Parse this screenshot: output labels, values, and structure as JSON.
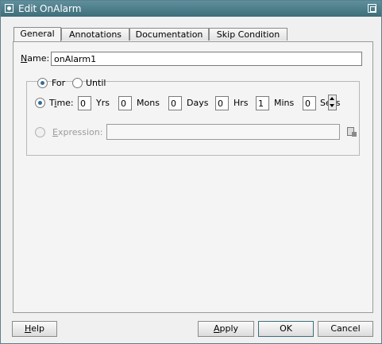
{
  "window": {
    "title": "Edit OnAlarm"
  },
  "tabs": [
    {
      "label": "General",
      "active": true
    },
    {
      "label": "Annotations",
      "active": false
    },
    {
      "label": "Documentation",
      "active": false
    },
    {
      "label": "Skip Condition",
      "active": false
    }
  ],
  "name": {
    "label": "Name:",
    "label_mnemonic": "N",
    "label_rest": "ame:",
    "value": "onAlarm1"
  },
  "mode": {
    "for_label": "For",
    "for_selected": true,
    "until_label": "Until",
    "until_selected": false
  },
  "time": {
    "label_mnemonic_pre": "T",
    "label_mnemonic": "i",
    "label_rest": "me:",
    "selected": true,
    "fields": [
      {
        "value": "0",
        "unit": "Yrs"
      },
      {
        "value": "0",
        "unit": "Mons"
      },
      {
        "value": "0",
        "unit": "Days"
      },
      {
        "value": "0",
        "unit": "Hrs"
      },
      {
        "value": "1",
        "unit": "Mins"
      },
      {
        "value": "0",
        "unit": "Secs"
      }
    ]
  },
  "expression": {
    "label_mnemonic": "E",
    "label_rest": "xpression:",
    "value": "",
    "enabled": false
  },
  "buttons": {
    "help_mnemonic": "H",
    "help_rest": "elp",
    "apply_mnemonic": "A",
    "apply_rest": "pply",
    "ok": "OK",
    "cancel": "Cancel"
  }
}
